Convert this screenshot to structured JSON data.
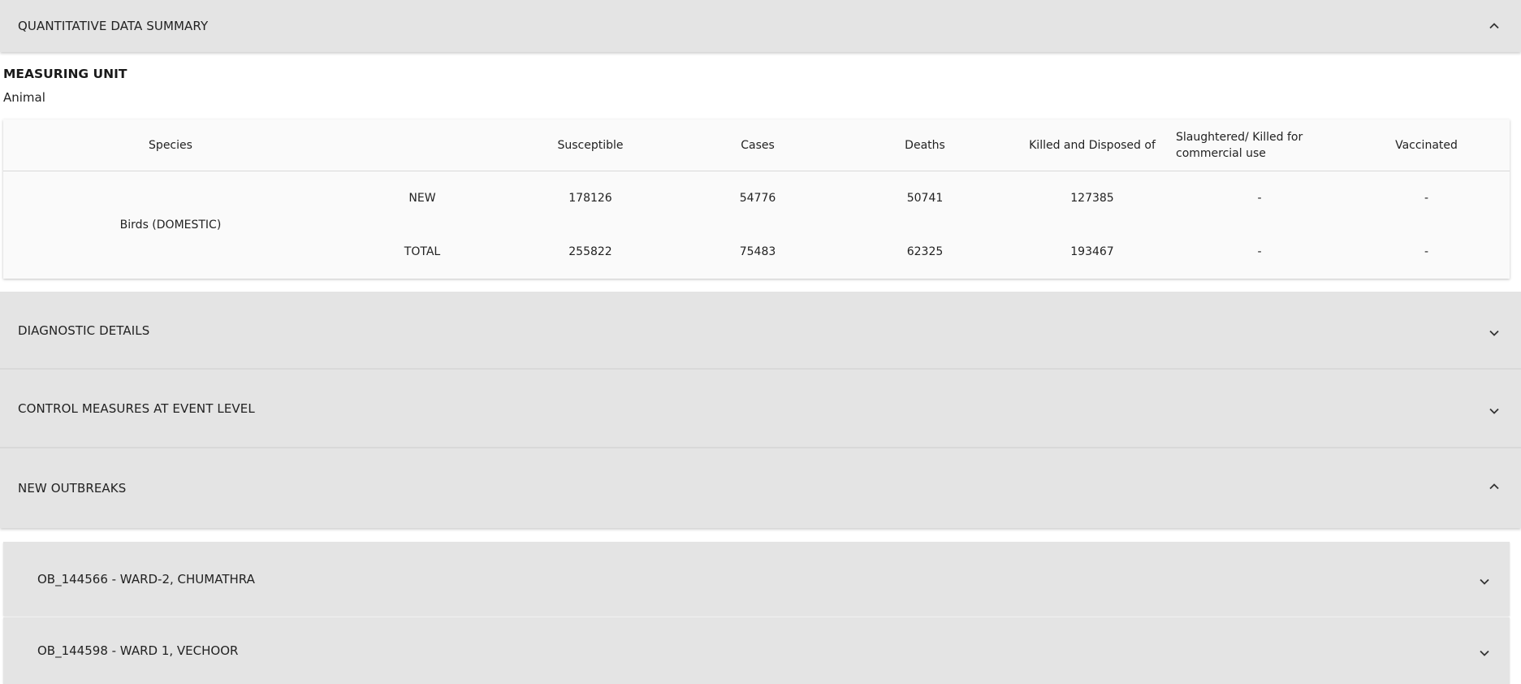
{
  "sections": {
    "quantitative": {
      "label": "QUANTITATIVE DATA SUMMARY",
      "expanded": true
    },
    "diagnostic": {
      "label": "DIAGNOSTIC DETAILS",
      "expanded": false
    },
    "control": {
      "label": "CONTROL MEASURES AT EVENT LEVEL",
      "expanded": false
    },
    "outbreaks": {
      "label": "NEW OUTBREAKS",
      "expanded": true
    }
  },
  "measuring_unit": {
    "title": "MEASURING UNIT",
    "value": "Animal"
  },
  "table": {
    "headers": {
      "species": "Species",
      "blank": "",
      "susceptible": "Susceptible",
      "cases": "Cases",
      "deaths": "Deaths",
      "killed": "Killed and Disposed of",
      "slaughtered": "Slaughtered/ Killed for commercial use",
      "vaccinated": "Vaccinated"
    },
    "species_name": "Birds (DOMESTIC)",
    "rows": [
      {
        "type": "NEW",
        "susceptible": "178126",
        "cases": "54776",
        "deaths": "50741",
        "killed": "127385",
        "slaughtered": "-",
        "vaccinated": "-"
      },
      {
        "type": "TOTAL",
        "susceptible": "255822",
        "cases": "75483",
        "deaths": "62325",
        "killed": "193467",
        "slaughtered": "-",
        "vaccinated": "-"
      }
    ]
  },
  "outbreaks": [
    {
      "label": "OB_144566 - WARD-2, CHUMATHRA"
    },
    {
      "label": "OB_144598 - WARD 1, VECHOOR"
    }
  ],
  "icons": {
    "expanded": "chevron-up-icon",
    "collapsed": "chevron-down-icon"
  }
}
